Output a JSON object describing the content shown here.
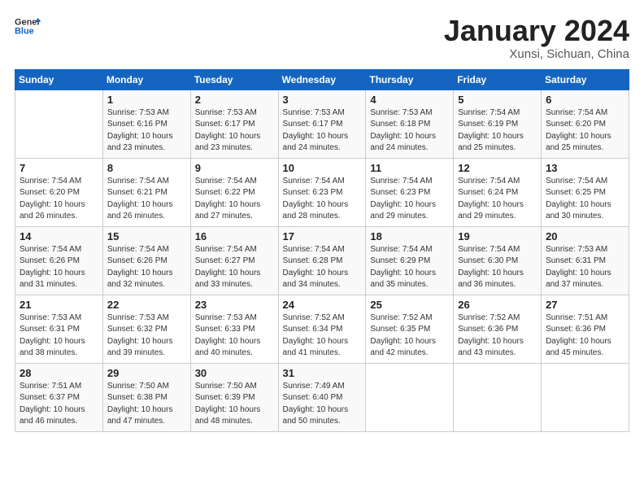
{
  "logo": {
    "line1": "General",
    "line2": "Blue"
  },
  "title": "January 2024",
  "subtitle": "Xunsi, Sichuan, China",
  "days_header": [
    "Sunday",
    "Monday",
    "Tuesday",
    "Wednesday",
    "Thursday",
    "Friday",
    "Saturday"
  ],
  "weeks": [
    [
      {
        "day": "",
        "sunrise": "",
        "sunset": "",
        "daylight": ""
      },
      {
        "day": "1",
        "sunrise": "Sunrise: 7:53 AM",
        "sunset": "Sunset: 6:16 PM",
        "daylight": "Daylight: 10 hours and 23 minutes."
      },
      {
        "day": "2",
        "sunrise": "Sunrise: 7:53 AM",
        "sunset": "Sunset: 6:17 PM",
        "daylight": "Daylight: 10 hours and 23 minutes."
      },
      {
        "day": "3",
        "sunrise": "Sunrise: 7:53 AM",
        "sunset": "Sunset: 6:17 PM",
        "daylight": "Daylight: 10 hours and 24 minutes."
      },
      {
        "day": "4",
        "sunrise": "Sunrise: 7:53 AM",
        "sunset": "Sunset: 6:18 PM",
        "daylight": "Daylight: 10 hours and 24 minutes."
      },
      {
        "day": "5",
        "sunrise": "Sunrise: 7:54 AM",
        "sunset": "Sunset: 6:19 PM",
        "daylight": "Daylight: 10 hours and 25 minutes."
      },
      {
        "day": "6",
        "sunrise": "Sunrise: 7:54 AM",
        "sunset": "Sunset: 6:20 PM",
        "daylight": "Daylight: 10 hours and 25 minutes."
      }
    ],
    [
      {
        "day": "7",
        "sunrise": "Sunrise: 7:54 AM",
        "sunset": "Sunset: 6:20 PM",
        "daylight": "Daylight: 10 hours and 26 minutes."
      },
      {
        "day": "8",
        "sunrise": "Sunrise: 7:54 AM",
        "sunset": "Sunset: 6:21 PM",
        "daylight": "Daylight: 10 hours and 26 minutes."
      },
      {
        "day": "9",
        "sunrise": "Sunrise: 7:54 AM",
        "sunset": "Sunset: 6:22 PM",
        "daylight": "Daylight: 10 hours and 27 minutes."
      },
      {
        "day": "10",
        "sunrise": "Sunrise: 7:54 AM",
        "sunset": "Sunset: 6:23 PM",
        "daylight": "Daylight: 10 hours and 28 minutes."
      },
      {
        "day": "11",
        "sunrise": "Sunrise: 7:54 AM",
        "sunset": "Sunset: 6:23 PM",
        "daylight": "Daylight: 10 hours and 29 minutes."
      },
      {
        "day": "12",
        "sunrise": "Sunrise: 7:54 AM",
        "sunset": "Sunset: 6:24 PM",
        "daylight": "Daylight: 10 hours and 29 minutes."
      },
      {
        "day": "13",
        "sunrise": "Sunrise: 7:54 AM",
        "sunset": "Sunset: 6:25 PM",
        "daylight": "Daylight: 10 hours and 30 minutes."
      }
    ],
    [
      {
        "day": "14",
        "sunrise": "Sunrise: 7:54 AM",
        "sunset": "Sunset: 6:26 PM",
        "daylight": "Daylight: 10 hours and 31 minutes."
      },
      {
        "day": "15",
        "sunrise": "Sunrise: 7:54 AM",
        "sunset": "Sunset: 6:26 PM",
        "daylight": "Daylight: 10 hours and 32 minutes."
      },
      {
        "day": "16",
        "sunrise": "Sunrise: 7:54 AM",
        "sunset": "Sunset: 6:27 PM",
        "daylight": "Daylight: 10 hours and 33 minutes."
      },
      {
        "day": "17",
        "sunrise": "Sunrise: 7:54 AM",
        "sunset": "Sunset: 6:28 PM",
        "daylight": "Daylight: 10 hours and 34 minutes."
      },
      {
        "day": "18",
        "sunrise": "Sunrise: 7:54 AM",
        "sunset": "Sunset: 6:29 PM",
        "daylight": "Daylight: 10 hours and 35 minutes."
      },
      {
        "day": "19",
        "sunrise": "Sunrise: 7:54 AM",
        "sunset": "Sunset: 6:30 PM",
        "daylight": "Daylight: 10 hours and 36 minutes."
      },
      {
        "day": "20",
        "sunrise": "Sunrise: 7:53 AM",
        "sunset": "Sunset: 6:31 PM",
        "daylight": "Daylight: 10 hours and 37 minutes."
      }
    ],
    [
      {
        "day": "21",
        "sunrise": "Sunrise: 7:53 AM",
        "sunset": "Sunset: 6:31 PM",
        "daylight": "Daylight: 10 hours and 38 minutes."
      },
      {
        "day": "22",
        "sunrise": "Sunrise: 7:53 AM",
        "sunset": "Sunset: 6:32 PM",
        "daylight": "Daylight: 10 hours and 39 minutes."
      },
      {
        "day": "23",
        "sunrise": "Sunrise: 7:53 AM",
        "sunset": "Sunset: 6:33 PM",
        "daylight": "Daylight: 10 hours and 40 minutes."
      },
      {
        "day": "24",
        "sunrise": "Sunrise: 7:52 AM",
        "sunset": "Sunset: 6:34 PM",
        "daylight": "Daylight: 10 hours and 41 minutes."
      },
      {
        "day": "25",
        "sunrise": "Sunrise: 7:52 AM",
        "sunset": "Sunset: 6:35 PM",
        "daylight": "Daylight: 10 hours and 42 minutes."
      },
      {
        "day": "26",
        "sunrise": "Sunrise: 7:52 AM",
        "sunset": "Sunset: 6:36 PM",
        "daylight": "Daylight: 10 hours and 43 minutes."
      },
      {
        "day": "27",
        "sunrise": "Sunrise: 7:51 AM",
        "sunset": "Sunset: 6:36 PM",
        "daylight": "Daylight: 10 hours and 45 minutes."
      }
    ],
    [
      {
        "day": "28",
        "sunrise": "Sunrise: 7:51 AM",
        "sunset": "Sunset: 6:37 PM",
        "daylight": "Daylight: 10 hours and 46 minutes."
      },
      {
        "day": "29",
        "sunrise": "Sunrise: 7:50 AM",
        "sunset": "Sunset: 6:38 PM",
        "daylight": "Daylight: 10 hours and 47 minutes."
      },
      {
        "day": "30",
        "sunrise": "Sunrise: 7:50 AM",
        "sunset": "Sunset: 6:39 PM",
        "daylight": "Daylight: 10 hours and 48 minutes."
      },
      {
        "day": "31",
        "sunrise": "Sunrise: 7:49 AM",
        "sunset": "Sunset: 6:40 PM",
        "daylight": "Daylight: 10 hours and 50 minutes."
      },
      {
        "day": "",
        "sunrise": "",
        "sunset": "",
        "daylight": ""
      },
      {
        "day": "",
        "sunrise": "",
        "sunset": "",
        "daylight": ""
      },
      {
        "day": "",
        "sunrise": "",
        "sunset": "",
        "daylight": ""
      }
    ]
  ]
}
